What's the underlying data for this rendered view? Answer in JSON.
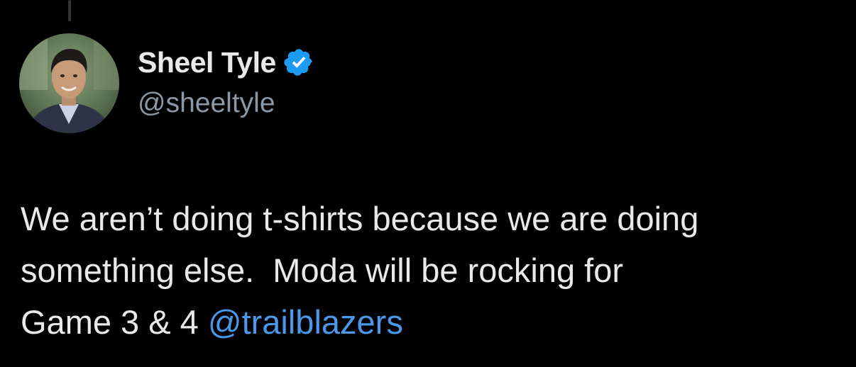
{
  "author": {
    "display_name": "Sheel Tyle",
    "handle": "@sheeltyle",
    "verified": true
  },
  "tweet": {
    "line1": "We aren’t doing t-shirts because we are doing",
    "line2": "something else.  Moda will be rocking for",
    "line3_prefix": "Game 3 & 4 ",
    "mention": "@trailblazers"
  },
  "colors": {
    "background": "#000000",
    "text": "#e7e9ea",
    "secondary_text": "#8b98a5",
    "mention": "#4a99e9",
    "verified_badge": "#1d9bf0"
  },
  "icons": {
    "verified": "verified-badge-icon"
  }
}
